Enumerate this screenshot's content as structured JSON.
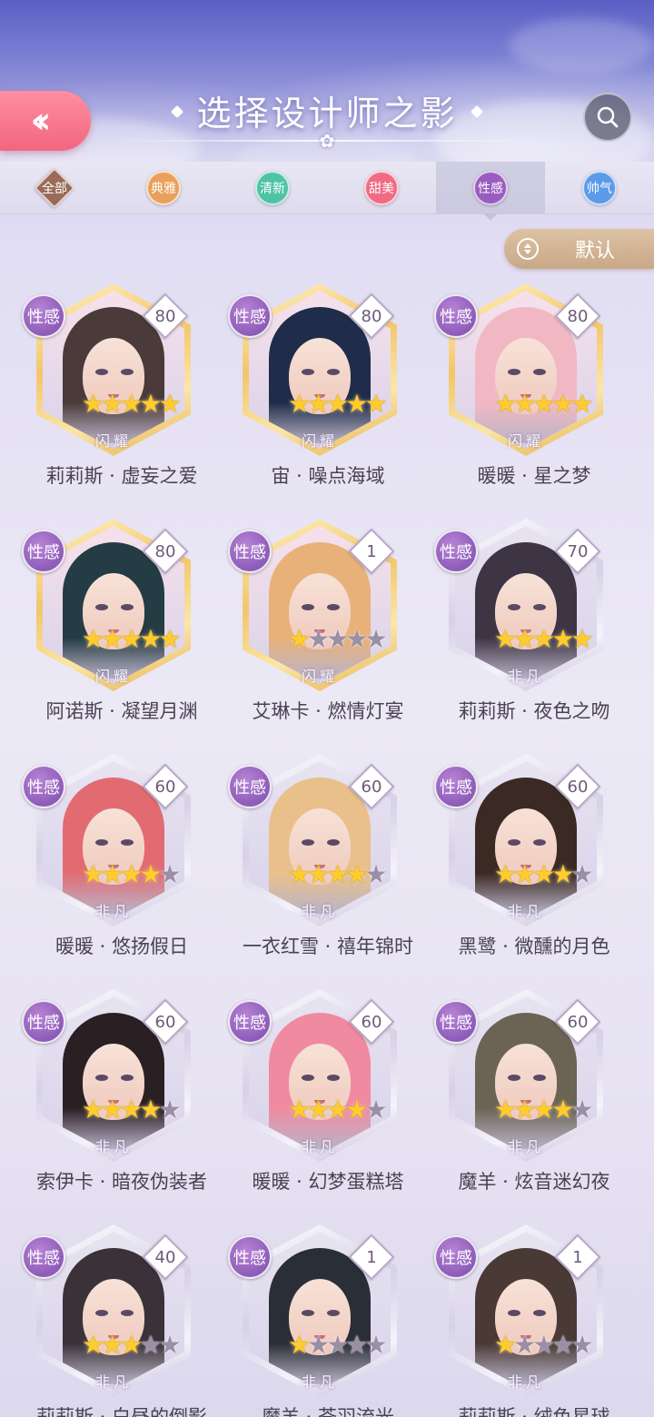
{
  "header": {
    "title": "选择设计师之影",
    "back_icon": "double-chevron-left-icon",
    "search_icon": "search-icon"
  },
  "tabs": [
    {
      "label": "全部",
      "color": "#9b6a58",
      "active": false,
      "shape": "diamond"
    },
    {
      "label": "典雅",
      "color": "#e8a05a",
      "active": false,
      "shape": "circle"
    },
    {
      "label": "清新",
      "color": "#4fc3a6",
      "active": false,
      "shape": "circle"
    },
    {
      "label": "甜美",
      "color": "#f06b84",
      "active": false,
      "shape": "circle"
    },
    {
      "label": "性感",
      "color": "#9a5cc0",
      "active": true,
      "shape": "circle"
    },
    {
      "label": "帅气",
      "color": "#5b9be8",
      "active": false,
      "shape": "circle"
    }
  ],
  "sort": {
    "label": "默认",
    "icon": "sort-toggle-icon"
  },
  "cards": [
    {
      "name": "莉莉斯 · 虚妄之爱",
      "type": "性感",
      "level": "80",
      "stars": 5,
      "tag": "闪耀",
      "frame": "gold",
      "hair": "#4a3a3a"
    },
    {
      "name": "宙 · 噪点海域",
      "type": "性感",
      "level": "80",
      "stars": 5,
      "tag": "闪耀",
      "frame": "gold",
      "hair": "#1f2c4a"
    },
    {
      "name": "暖暖 · 星之梦",
      "type": "性感",
      "level": "80",
      "stars": 5,
      "tag": "闪耀",
      "frame": "gold",
      "hair": "#f1b8c4"
    },
    {
      "name": "阿诺斯 · 凝望月渊",
      "type": "性感",
      "level": "80",
      "stars": 5,
      "tag": "闪耀",
      "frame": "gold",
      "hair": "#243c44"
    },
    {
      "name": "艾琳卡 · 燃情灯宴",
      "type": "性感",
      "level": "1",
      "stars": 1,
      "tag": "闪耀",
      "frame": "gold",
      "hair": "#e8b17a"
    },
    {
      "name": "莉莉斯 · 夜色之吻",
      "type": "性感",
      "level": "70",
      "stars": 5,
      "tag": "非凡",
      "frame": "silver",
      "hair": "#3d3444"
    },
    {
      "name": "暖暖 · 悠扬假日",
      "type": "性感",
      "level": "60",
      "stars": 4,
      "tag": "非凡",
      "frame": "silver",
      "hair": "#e26b72"
    },
    {
      "name": "一衣红雪 · 禧年锦时",
      "type": "性感",
      "level": "60",
      "stars": 4,
      "tag": "非凡",
      "frame": "silver",
      "hair": "#e9c08a"
    },
    {
      "name": "黑鹭 · 微醺的月色",
      "type": "性感",
      "level": "60",
      "stars": 4,
      "tag": "非凡",
      "frame": "silver",
      "hair": "#3b2a24"
    },
    {
      "name": "索伊卡 · 暗夜伪装者",
      "type": "性感",
      "level": "60",
      "stars": 4,
      "tag": "非凡",
      "frame": "silver",
      "hair": "#2a2024"
    },
    {
      "name": "暖暖 · 幻梦蛋糕塔",
      "type": "性感",
      "level": "60",
      "stars": 4,
      "tag": "非凡",
      "frame": "silver",
      "hair": "#f08aa0"
    },
    {
      "name": "魔羊 · 炫音迷幻夜",
      "type": "性感",
      "level": "60",
      "stars": 4,
      "tag": "非凡",
      "frame": "silver",
      "hair": "#6b6454"
    },
    {
      "name": "莉莉斯 · 白昼的倒影",
      "type": "性感",
      "level": "40",
      "stars": 3,
      "tag": "非凡",
      "frame": "silver",
      "hair": "#3a3238"
    },
    {
      "name": "魔羊 · 苍羽流光",
      "type": "性感",
      "level": "1",
      "stars": 1,
      "tag": "非凡",
      "frame": "silver",
      "hair": "#2a2e36"
    },
    {
      "name": "莉莉斯 · 绒色星球",
      "type": "性感",
      "level": "1",
      "stars": 1,
      "tag": "非凡",
      "frame": "silver",
      "hair": "#4a3a36"
    }
  ],
  "colors": {
    "gold_frame": "#f4d48a",
    "silver_frame": "#c9c4dc",
    "star_on": "#ffcc2e",
    "star_off": "#9a8fa6",
    "type_badge": "#9a5cc0",
    "sort_button": "#cfae8c",
    "back_button": "#f2667f"
  }
}
